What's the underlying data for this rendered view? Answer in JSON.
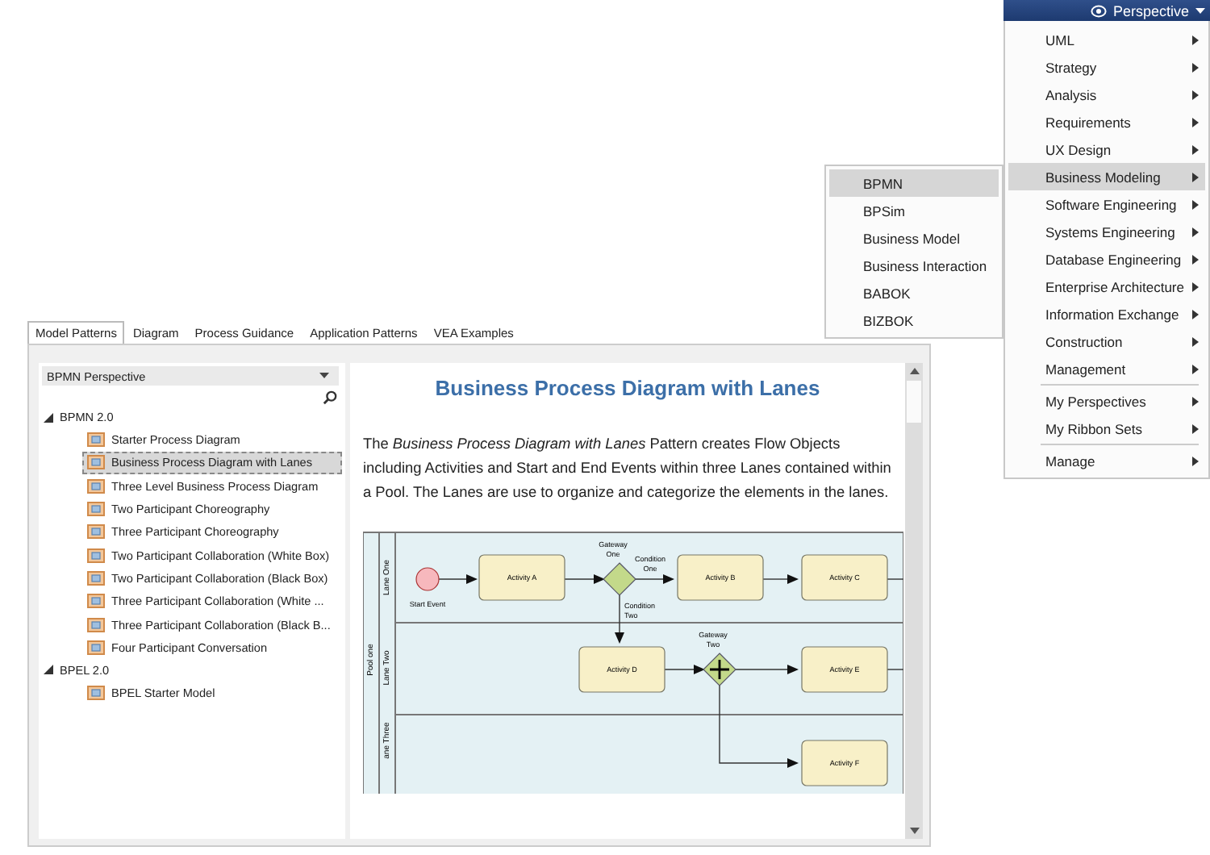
{
  "perspective_button": {
    "label": "Perspective"
  },
  "perspective_menu": {
    "groups": [
      [
        {
          "label": "UML",
          "selected": false
        },
        {
          "label": "Strategy",
          "selected": false
        },
        {
          "label": "Analysis",
          "selected": false
        },
        {
          "label": "Requirements",
          "selected": false
        },
        {
          "label": "UX Design",
          "selected": false
        },
        {
          "label": "Business Modeling",
          "selected": true
        },
        {
          "label": "Software Engineering",
          "selected": false
        },
        {
          "label": "Systems Engineering",
          "selected": false
        },
        {
          "label": "Database Engineering",
          "selected": false
        },
        {
          "label": "Enterprise Architecture",
          "selected": false
        },
        {
          "label": "Information Exchange",
          "selected": false
        },
        {
          "label": "Construction",
          "selected": false
        },
        {
          "label": "Management",
          "selected": false
        }
      ],
      [
        {
          "label": "My Perspectives",
          "selected": false
        },
        {
          "label": "My Ribbon Sets",
          "selected": false
        }
      ],
      [
        {
          "label": "Manage",
          "selected": false
        }
      ]
    ]
  },
  "submenu": {
    "items": [
      {
        "label": "BPMN",
        "selected": true
      },
      {
        "label": "BPSim",
        "selected": false
      },
      {
        "label": "Business Model",
        "selected": false
      },
      {
        "label": "Business Interaction",
        "selected": false
      },
      {
        "label": "BABOK",
        "selected": false
      },
      {
        "label": "BIZBOK",
        "selected": false
      }
    ]
  },
  "tabs": [
    {
      "label": "Model Patterns",
      "selected": true
    },
    {
      "label": "Diagram",
      "selected": false
    },
    {
      "label": "Process Guidance",
      "selected": false
    },
    {
      "label": "Application Patterns",
      "selected": false
    },
    {
      "label": "VEA Examples",
      "selected": false
    }
  ],
  "tree": {
    "dropdown": "BPMN Perspective",
    "nodes": [
      {
        "label": "BPMN 2.0",
        "expanded": true,
        "children": [
          {
            "label": "Starter Process Diagram",
            "selected": false
          },
          {
            "label": "Business Process Diagram with Lanes",
            "selected": true
          },
          {
            "label": "Three Level Business Process Diagram",
            "selected": false
          },
          {
            "label": "Two Participant Choreography",
            "selected": false
          },
          {
            "label": "Three Participant Choreography",
            "selected": false
          },
          {
            "label": "Two Participant Collaboration (White Box)",
            "selected": false
          },
          {
            "label": "Two Participant Collaboration (Black Box)",
            "selected": false
          },
          {
            "label": "Three Participant Collaboration (White ...",
            "selected": false
          },
          {
            "label": "Three Participant Collaboration (Black B...",
            "selected": false
          },
          {
            "label": "Four Participant Conversation",
            "selected": false
          }
        ]
      },
      {
        "label": "BPEL 2.0",
        "expanded": true,
        "children": [
          {
            "label": "BPEL Starter Model",
            "selected": false
          }
        ]
      }
    ]
  },
  "content": {
    "title": "Business Process Diagram with Lanes",
    "description": "The *Business Process Diagram with Lanes* Pattern creates Flow Objects including Activities and Start and End Events within three Lanes contained within a Pool. The Lanes are use to organize and categorize the elements in the lanes."
  },
  "diagram": {
    "pool": "Pool one",
    "lanes": [
      "Lane One",
      "Lane Two",
      "ane Three"
    ],
    "nodes": [
      {
        "kind": "start",
        "label": "Start Event"
      },
      {
        "kind": "activity",
        "label": "Activity A"
      },
      {
        "kind": "gateway",
        "label": "Gateway One"
      },
      {
        "kind": "activity",
        "label": "Activity B"
      },
      {
        "kind": "activity",
        "label": "Activity C"
      },
      {
        "kind": "activity",
        "label": "Activity D"
      },
      {
        "kind": "parallel",
        "label": "Gateway Two"
      },
      {
        "kind": "activity",
        "label": "Activity E"
      },
      {
        "kind": "activity",
        "label": "Activity F"
      }
    ],
    "edge_labels": [
      "Condition One",
      "Condition Two"
    ]
  }
}
